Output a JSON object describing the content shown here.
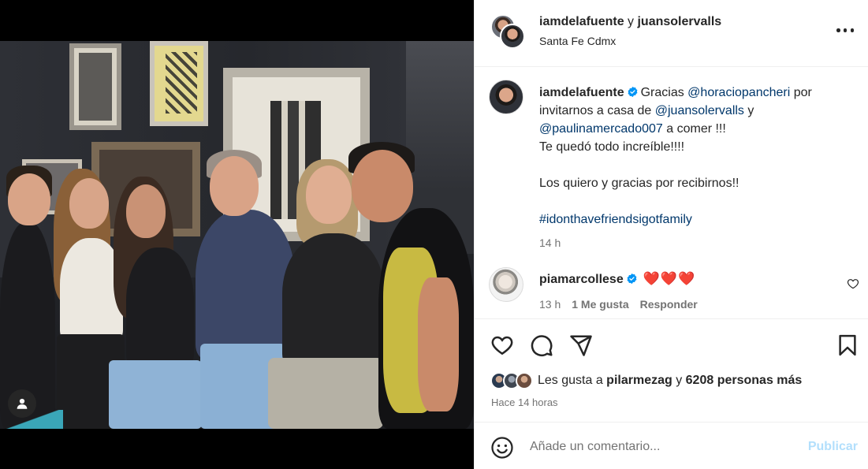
{
  "post": {
    "header": {
      "author": "iamdelafuente",
      "connector": " y ",
      "coauthor": "juansolervalls",
      "location": "Santa Fe Cdmx"
    },
    "caption": {
      "author": "iamdelafuente",
      "text_1": "Gracias ",
      "mention_1": "@horaciopancheri",
      "text_2": " por invitarnos a casa de ",
      "mention_2": "@juansolervalls",
      "text_3": " y ",
      "mention_3": "@paulinamercado007",
      "text_4": " a comer !!!",
      "line_2": "Te quedó todo increíble!!!!",
      "line_3": "Los quiero y gracias por recibirnos!!",
      "hashtag": "#idonthavefriendsigotfamily",
      "time": "14 h"
    },
    "comment": {
      "author": "piamarcollese",
      "text": "❤️❤️❤️",
      "time": "13 h",
      "likes": "1 Me gusta",
      "reply": "Responder"
    },
    "likes": {
      "prefix": "Les gusta a ",
      "user": "pilarmezag",
      "middle": " y ",
      "count": "6208 personas más"
    },
    "posted_ago": "Hace 14 horas",
    "composer": {
      "placeholder": "Añade un comentario...",
      "publish": "Publicar"
    }
  },
  "icons": {
    "more": "more-options-icon",
    "verified": "verified-badge-icon",
    "like": "heart-icon",
    "comment": "comment-icon",
    "share": "share-icon",
    "save": "bookmark-icon",
    "emoji": "emoji-icon",
    "user": "user-tag-icon"
  },
  "colors": {
    "link": "#00376b",
    "verified": "#0095f6",
    "muted": "#737373",
    "publish_disabled": "#b2dffc"
  }
}
